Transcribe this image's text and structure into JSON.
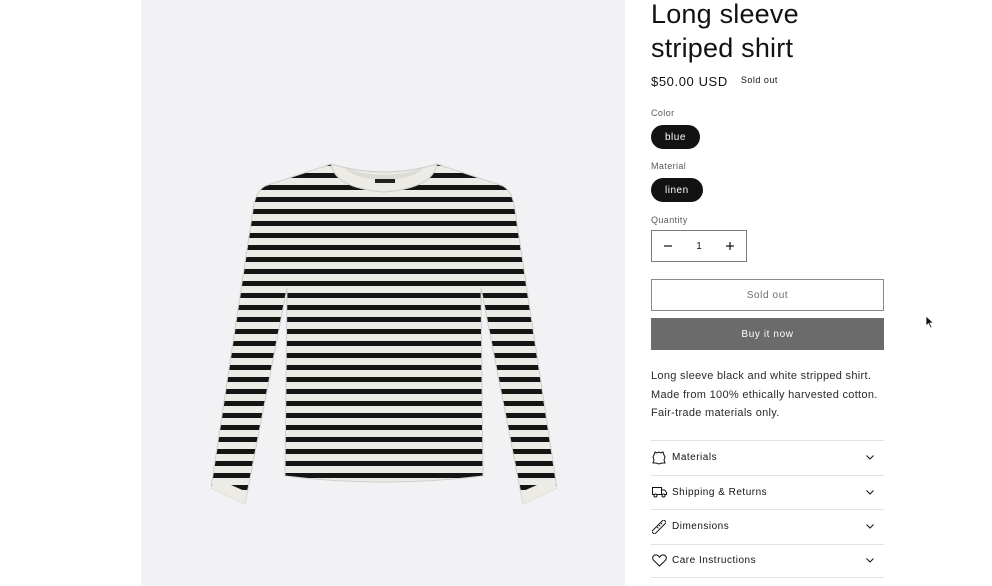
{
  "product": {
    "title": "Long sleeve striped shirt",
    "price": "$50.00 USD",
    "badge": "Sold out",
    "image_icon": "striped-shirt-image"
  },
  "options": {
    "color_label": "Color",
    "color_value": "blue",
    "material_label": "Material",
    "material_value": "linen"
  },
  "quantity": {
    "label": "Quantity",
    "value": "1",
    "decrease_icon": "minus-icon",
    "increase_icon": "plus-icon"
  },
  "buttons": {
    "sold_out": "Sold out",
    "buy_now": "Buy it now"
  },
  "description": {
    "line1": "Long sleeve black and white stripped shirt.",
    "line2": "Made from 100% ethically harvested cotton.",
    "line3": "Fair-trade materials only."
  },
  "accordion": [
    {
      "label": "Materials",
      "icon": "leather-icon"
    },
    {
      "label": "Shipping & Returns",
      "icon": "truck-icon"
    },
    {
      "label": "Dimensions",
      "icon": "ruler-icon"
    },
    {
      "label": "Care Instructions",
      "icon": "heart-icon"
    }
  ],
  "colors": {
    "primary": "#121212",
    "buy_button": "#6b6b6b",
    "media_bg": "#f2f2f4"
  }
}
